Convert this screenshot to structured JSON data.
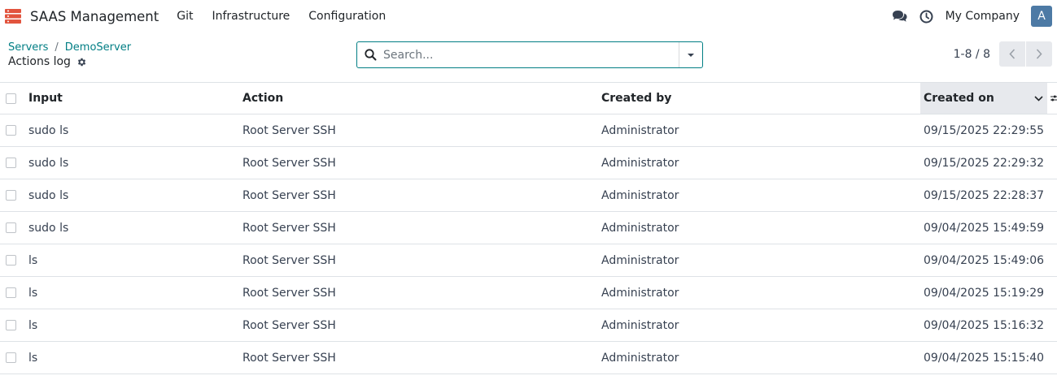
{
  "navbar": {
    "app_name": "SAAS Management",
    "menu": [
      "Git",
      "Infrastructure",
      "Configuration"
    ],
    "company": "My Company",
    "avatar_letter": "A",
    "icons": [
      "app-logo-icon",
      "chat-icon",
      "clock-icon"
    ]
  },
  "control_panel": {
    "breadcrumb": [
      "Servers",
      "DemoServer"
    ],
    "breadcrumb_separator": "/",
    "title": "Actions log",
    "search": {
      "placeholder": "Search...",
      "value": ""
    },
    "pager": "1-8 / 8"
  },
  "table": {
    "columns": [
      "Input",
      "Action",
      "Created by",
      "Created on"
    ],
    "sorted_column": "Created on",
    "rows": [
      {
        "input": "sudo ls",
        "action": "Root Server SSH",
        "created_by": "Administrator",
        "created_on": "09/15/2025 22:29:55"
      },
      {
        "input": "sudo ls",
        "action": "Root Server SSH",
        "created_by": "Administrator",
        "created_on": "09/15/2025 22:29:32"
      },
      {
        "input": "sudo ls",
        "action": "Root Server SSH",
        "created_by": "Administrator",
        "created_on": "09/15/2025 22:28:37"
      },
      {
        "input": "sudo ls",
        "action": "Root Server SSH",
        "created_by": "Administrator",
        "created_on": "09/04/2025 15:49:59"
      },
      {
        "input": "ls",
        "action": "Root Server SSH",
        "created_by": "Administrator",
        "created_on": "09/04/2025 15:49:06"
      },
      {
        "input": "ls",
        "action": "Root Server SSH",
        "created_by": "Administrator",
        "created_on": "09/04/2025 15:19:29"
      },
      {
        "input": "ls",
        "action": "Root Server SSH",
        "created_by": "Administrator",
        "created_on": "09/04/2025 15:16:32"
      },
      {
        "input": "ls",
        "action": "Root Server SSH",
        "created_by": "Administrator",
        "created_on": "09/04/2025 15:15:40"
      }
    ]
  },
  "colors": {
    "accent": "#017e84",
    "avatar": "#4d7aa5",
    "app_icon": "#e2543e"
  }
}
